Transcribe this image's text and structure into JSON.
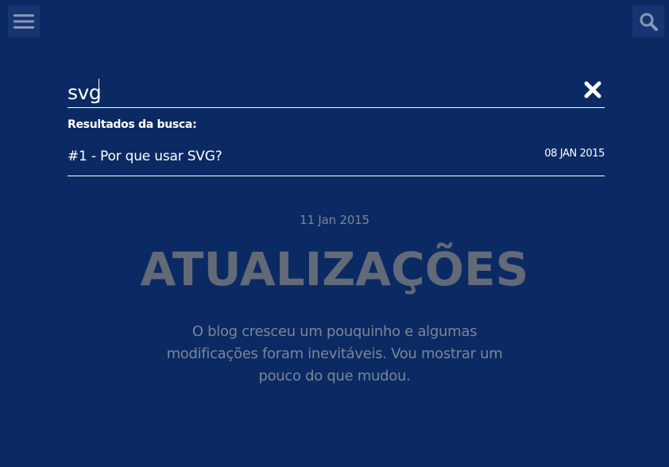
{
  "header": {
    "menu_icon": "hamburger-menu-icon",
    "search_icon": "search-icon"
  },
  "search": {
    "value": "svg",
    "close_icon": "close-icon",
    "results_label": "Resultados da busca:",
    "results": [
      {
        "title": "#1 - Por que usar SVG?",
        "date": "08 JAN 2015"
      }
    ]
  },
  "article": {
    "date": "11 Jan 2015",
    "title": "ATUALIZAÇÕES",
    "excerpt": "O blog cresceu um pouquinho e algumas modificações foram inevitáveis. Vou mostrar um pouco do que mudou."
  },
  "colors": {
    "background": "#0b2a63",
    "button_bg": "#163673",
    "text": "#ffffff",
    "muted_title": "#626a78",
    "muted_text": "#7b8597"
  }
}
